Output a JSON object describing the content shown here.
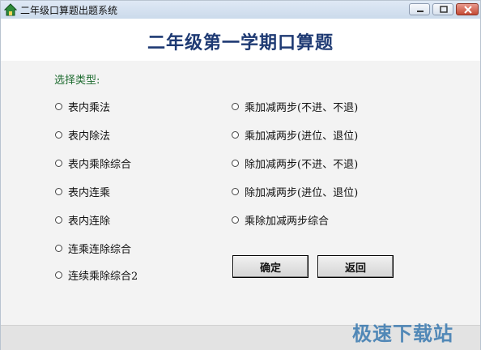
{
  "window": {
    "title": "二年级口算题出题系统",
    "icon": "house-app-icon",
    "controls": [
      "minimize-icon",
      "maximize-icon",
      "close-icon"
    ]
  },
  "header": {
    "title": "二年级第一学期口算题"
  },
  "main": {
    "section_label": "选择类型:",
    "left_options": [
      "表内乘法",
      "表内除法",
      "表内乘除综合",
      "表内连乘",
      "表内连除",
      "连乘连除综合",
      "连续乘除综合2"
    ],
    "right_options": [
      "乘加减两步(不进、不退)",
      "乘加减两步(进位、退位)",
      "除加减两步(不进、不退)",
      "除加减两步(进位、退位)",
      "乘除加减两步综合"
    ],
    "confirm_label": "确定",
    "back_label": "返回"
  },
  "watermark": {
    "text": "极速下载站"
  },
  "colors": {
    "title": "#1e3a73",
    "section_label": "#1d6b2f",
    "titlebar": "#cbdaeb"
  }
}
